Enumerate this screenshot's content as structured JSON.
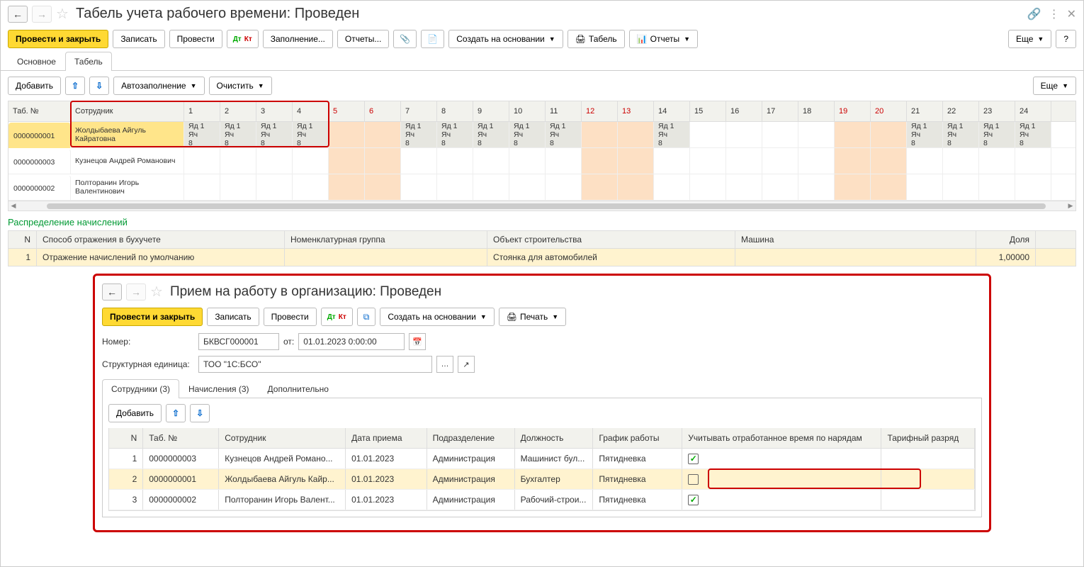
{
  "header": {
    "title": "Табель учета рабочего времени: Проведен"
  },
  "toolbar": {
    "post_close": "Провести и закрыть",
    "write": "Записать",
    "post": "Провести",
    "fill": "Заполнение...",
    "reports": "Отчеты...",
    "create_based": "Создать на основании",
    "print_tabel": "Табель",
    "reports2": "Отчеты",
    "more": "Еще",
    "help": "?"
  },
  "tabs": {
    "main": "Основное",
    "tabel": "Табель"
  },
  "subtoolbar": {
    "add": "Добавить",
    "autofill": "Автозаполнение",
    "clear": "Очистить",
    "more": "Еще"
  },
  "ts": {
    "cols": {
      "tab_no": "Таб. №",
      "employee": "Сотрудник"
    },
    "days": [
      1,
      2,
      3,
      4,
      5,
      6,
      7,
      8,
      9,
      10,
      11,
      12,
      13,
      14,
      15,
      16,
      17,
      18,
      19,
      20,
      21,
      22,
      23,
      24
    ],
    "weekend_days": [
      5,
      6,
      12,
      13,
      19,
      20
    ],
    "rows": [
      {
        "tab_no": "0000000001",
        "name": "Жолдыбаева Айгуль Кайратовна",
        "cells": {
          "1": "Яд 1 Яч 8",
          "2": "Яд 1 Яч 8",
          "3": "Яд 1 Яч 8",
          "4": "Яд 1 Яч 8",
          "7": "Яд 1 Яч 8",
          "8": "Яд 1 Яч 8",
          "9": "Яд 1 Яч 8",
          "10": "Яд 1 Яч 8",
          "11": "Яд 1 Яч 8",
          "14": "Яд 1 Яч 8",
          "21": "Яд 1 Яч 8",
          "22": "Яд 1 Яч 8",
          "23": "Яд 1 Яч 8",
          "24": "Яд 1 Яч 8"
        }
      },
      {
        "tab_no": "0000000003",
        "name": "Кузнецов Андрей Романович",
        "cells": {}
      },
      {
        "tab_no": "0000000002",
        "name": "Полторанин Игорь Валентинович",
        "cells": {}
      }
    ]
  },
  "alloc": {
    "title": "Распределение начислений",
    "cols": {
      "n": "N",
      "method": "Способ отражения в бухучете",
      "nom": "Номенклатурная группа",
      "obj": "Объект строительства",
      "mach": "Машина",
      "share": "Доля"
    },
    "row": {
      "n": "1",
      "method": "Отражение начислений по умолчанию",
      "nom": "",
      "obj": "Стоянка для автомобилей",
      "mach": "",
      "share": "1,00000"
    }
  },
  "sub": {
    "title": "Прием на работу в организацию: Проведен",
    "toolbar": {
      "post_close": "Провести и закрыть",
      "write": "Записать",
      "post": "Провести",
      "create_based": "Создать на основании",
      "print": "Печать"
    },
    "form": {
      "number_label": "Номер:",
      "number": "БКВСГ000001",
      "from_label": "от:",
      "from": "01.01.2023  0:00:00",
      "org_label": "Структурная единица:",
      "org": "ТОО \"1С:БСО\""
    },
    "tabs": {
      "emp": "Сотрудники (3)",
      "accr": "Начисления (3)",
      "extra": "Дополнительно"
    },
    "grid": {
      "add": "Добавить",
      "cols": {
        "n": "N",
        "tab": "Таб. №",
        "emp": "Сотрудник",
        "date": "Дата приема",
        "dept": "Подразделение",
        "pos": "Должность",
        "sched": "График работы",
        "track": "Учитывать отработанное время по нарядам",
        "grade": "Тарифный разряд"
      },
      "rows": [
        {
          "n": "1",
          "tab": "0000000003",
          "emp": "Кузнецов Андрей Романо...",
          "date": "01.01.2023",
          "dept": "Администрация",
          "pos": "Машинист бул...",
          "sched": "Пятидневка",
          "track": true
        },
        {
          "n": "2",
          "tab": "0000000001",
          "emp": "Жолдыбаева Айгуль Кайр...",
          "date": "01.01.2023",
          "dept": "Администрация",
          "pos": "Бухгалтер",
          "sched": "Пятидневка",
          "track": false
        },
        {
          "n": "3",
          "tab": "0000000002",
          "emp": "Полторанин Игорь Валент...",
          "date": "01.01.2023",
          "dept": "Администрация",
          "pos": "Рабочий-строи...",
          "sched": "Пятидневка",
          "track": true
        }
      ]
    }
  }
}
